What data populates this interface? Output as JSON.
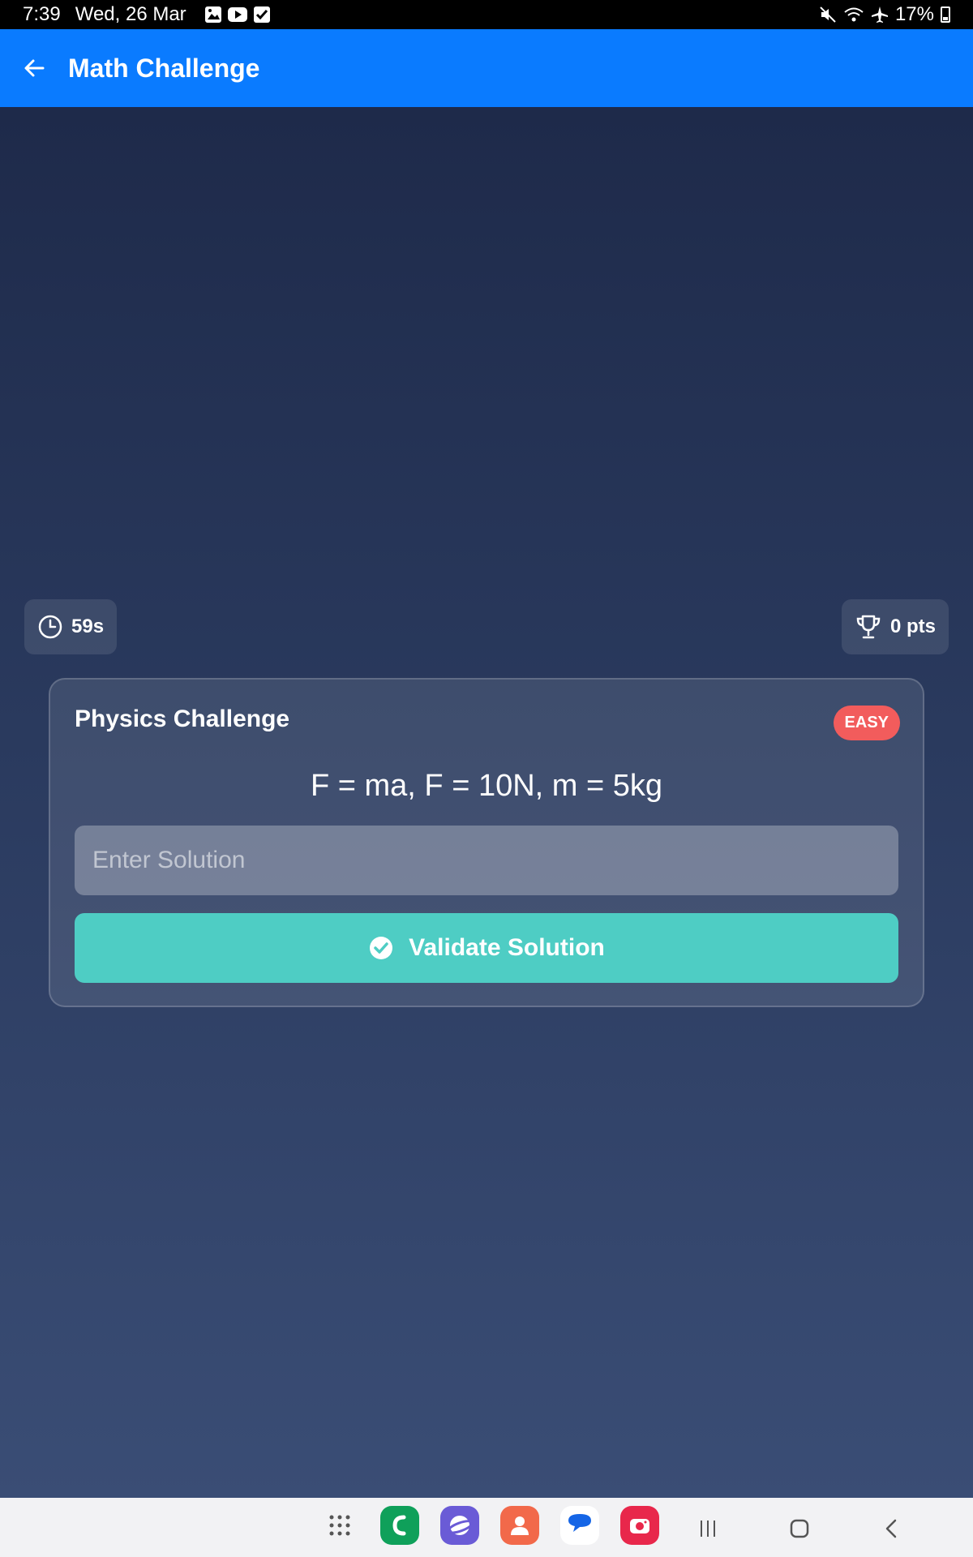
{
  "status_bar": {
    "time": "7:39",
    "date": "Wed, 26 Mar",
    "battery": "17%",
    "left_icons": [
      "gallery-icon",
      "youtube-icon",
      "check-icon"
    ],
    "right_icons": [
      "mute-icon",
      "wifi-icon",
      "airplane-icon",
      "battery-icon"
    ]
  },
  "app_bar": {
    "title": "Math Challenge",
    "back_icon": "back-arrow-icon",
    "color": "#0a7bff"
  },
  "stats": {
    "timer": "59s",
    "timer_icon": "clock-icon",
    "score": "0 pts",
    "score_icon": "trophy-icon"
  },
  "challenge": {
    "title": "Physics Challenge",
    "difficulty": "EASY",
    "difficulty_color": "#f25c5c",
    "problem": "F = ma, F = 10N, m = 5kg",
    "input_placeholder": "Enter Solution",
    "input_value": "",
    "validate_label": "Validate Solution",
    "validate_color": "#4ecdc4"
  },
  "nav_bar": {
    "dock_apps": [
      "app-drawer-icon",
      "phone-icon",
      "internet-icon",
      "contacts-icon",
      "messages-icon",
      "camera-icon"
    ],
    "system_buttons": [
      "recents-icon",
      "home-icon",
      "back-icon"
    ]
  }
}
